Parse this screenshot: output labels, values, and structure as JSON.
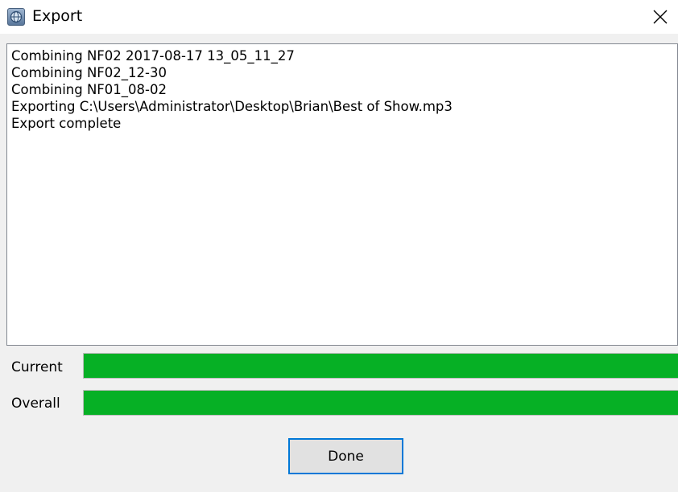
{
  "window": {
    "title": "Export",
    "icon": "app-globe-icon",
    "close_icon": "close-icon"
  },
  "log": {
    "lines": [
      "Combining NF02 2017-08-17 13_05_11_27",
      "Combining NF02_12-30",
      "Combining NF01_08-02",
      "Exporting C:\\Users\\Administrator\\Desktop\\Brian\\Best of Show.mp3",
      "Export complete"
    ]
  },
  "progress": {
    "current": {
      "label": "Current",
      "value": 1.0
    },
    "overall": {
      "label": "Overall",
      "value": 1.0
    },
    "fill_color": "#06b025"
  },
  "buttons": {
    "done_label": "Done"
  }
}
